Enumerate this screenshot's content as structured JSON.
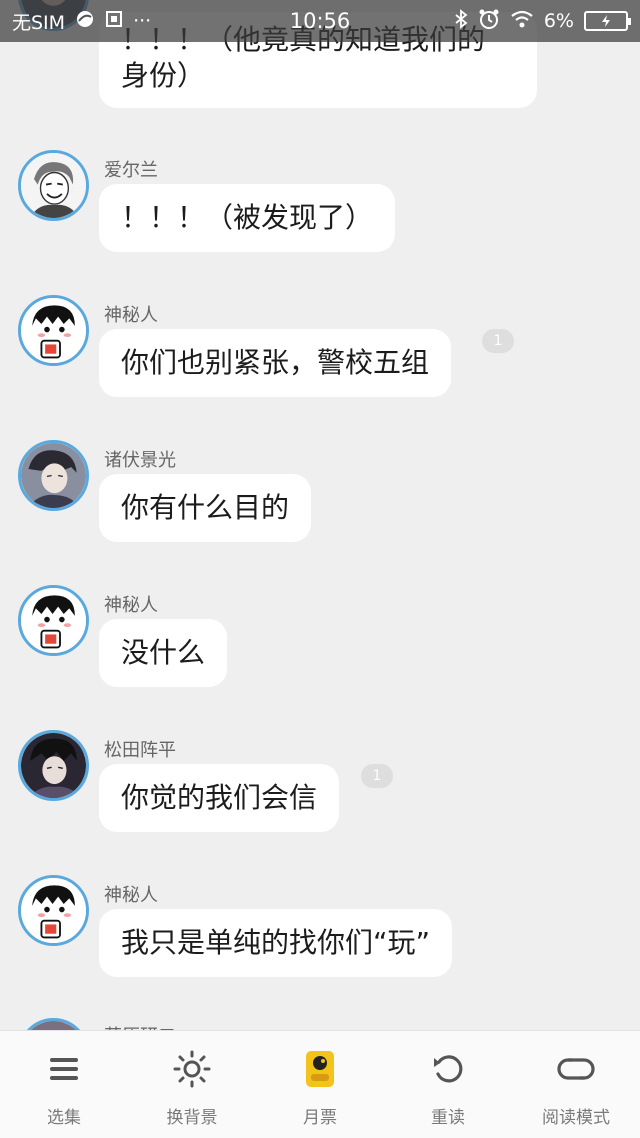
{
  "status_bar": {
    "carrier": "无SIM",
    "time": "10:56",
    "battery": "6%",
    "more_dots": "···"
  },
  "messages": [
    {
      "sender": "",
      "text_lines": [
        "！！！（他竟真的知道我们的",
        "身份）"
      ],
      "badge": ""
    },
    {
      "sender": "爱尔兰",
      "text": "！！！（被发现了）",
      "badge": ""
    },
    {
      "sender": "神秘人",
      "text": "你们也别紧张，警校五组",
      "badge": "1"
    },
    {
      "sender": "诸伏景光",
      "text": "你有什么目的",
      "badge": ""
    },
    {
      "sender": "神秘人",
      "text": "没什么",
      "badge": ""
    },
    {
      "sender": "松田阵平",
      "text": "你觉的我们会信",
      "badge": "1"
    },
    {
      "sender": "神秘人",
      "text": "我只是单纯的找你们“玩”",
      "badge": ""
    },
    {
      "sender": "萩原研二",
      "text": "",
      "badge": ""
    }
  ],
  "toolbar": {
    "items": [
      {
        "label": "选集",
        "icon": "menu-icon"
      },
      {
        "label": "换背景",
        "icon": "sun-icon"
      },
      {
        "label": "月票",
        "icon": "monthly-ticket-icon"
      },
      {
        "label": "重读",
        "icon": "reload-icon"
      },
      {
        "label": "阅读模式",
        "icon": "loop-icon"
      }
    ]
  },
  "colors": {
    "background": "#efefef",
    "bubble": "#ffffff",
    "avatar_ring": "#5aa9de",
    "ticket_yellow": "#f3c21b"
  }
}
